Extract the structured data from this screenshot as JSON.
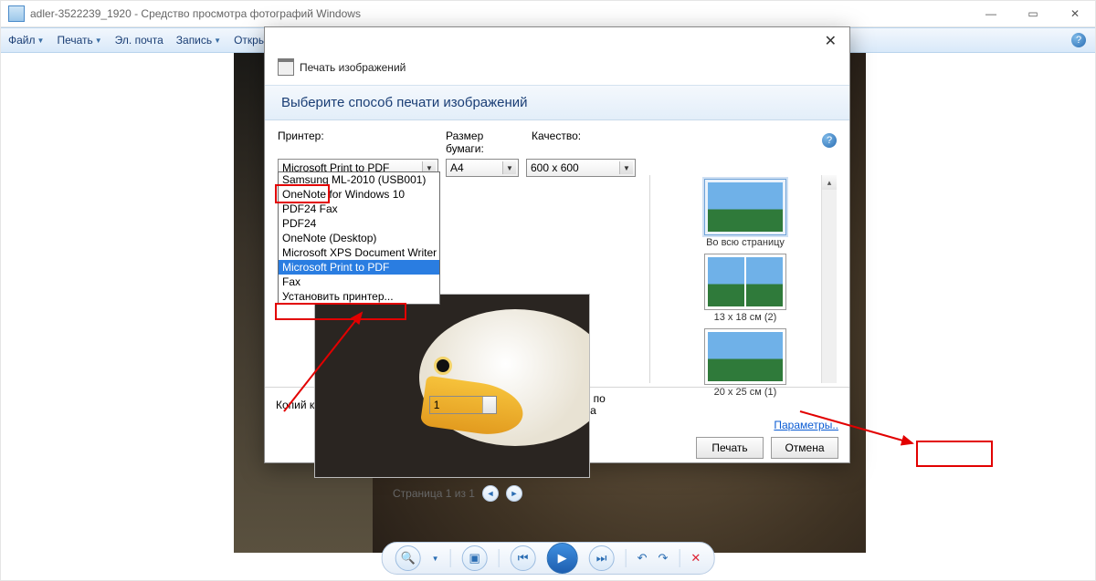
{
  "window": {
    "title": "adler-3522239_1920 - Средство просмотра фотографий Windows"
  },
  "menu": {
    "file": "Файл",
    "print": "Печать",
    "email": "Эл. почта",
    "burn": "Запись",
    "open": "Открыть"
  },
  "dialog": {
    "title": "Печать изображений",
    "banner": "Выберите способ печати изображений",
    "labels": {
      "printer": "Принтер:",
      "paper": "Размер бумаги:",
      "quality": "Качество:"
    },
    "printer_selected": "Microsoft Print to PDF",
    "printer_list": [
      "Samsung ML-2010 (USB001)",
      "OneNote for Windows 10",
      "PDF24 Fax",
      "PDF24",
      "OneNote (Desktop)",
      "Microsoft XPS Document Writer",
      "Microsoft Print to PDF",
      "Fax",
      "Установить принтер..."
    ],
    "paper": "A4",
    "quality": "600 x 600",
    "pager": "Страница 1 из 1",
    "layouts": {
      "full": "Во всю страницу",
      "l2": "13 x 18 см (2)",
      "l3": "20 x 25 см (1)"
    },
    "copies_label": "Копий каждого изображения:",
    "copies_value": "1",
    "fit_label": "Изображение по размеру кадра",
    "options_link": "Параметры..",
    "btn_print": "Печать",
    "btn_cancel": "Отмена"
  }
}
